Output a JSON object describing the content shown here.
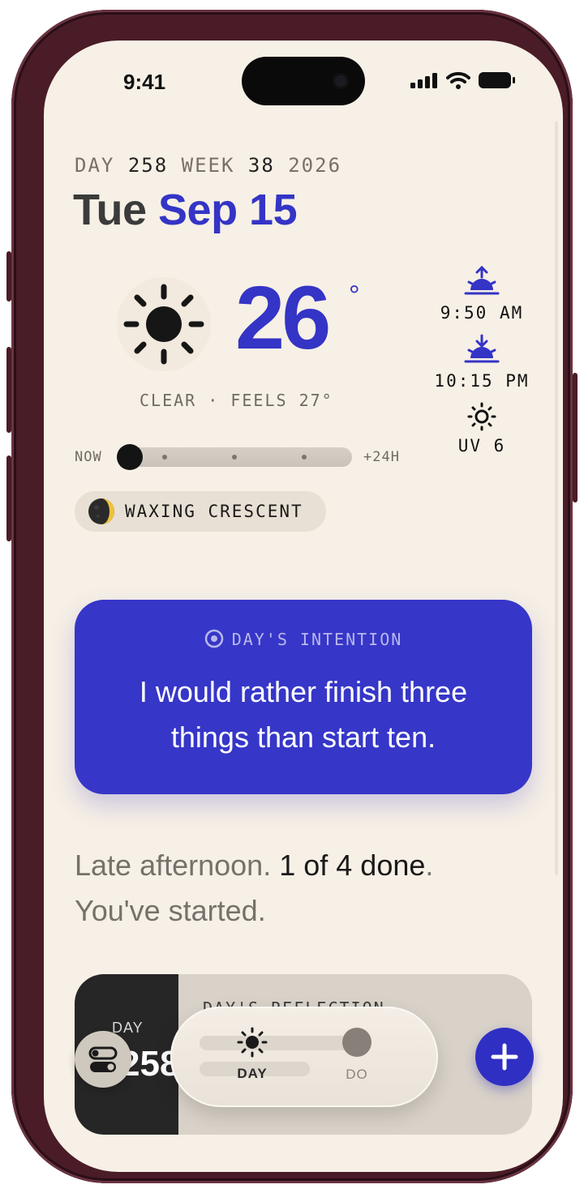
{
  "status_bar": {
    "time": "9:41"
  },
  "date_header": {
    "day_label": "DAY",
    "day_number": "258",
    "week_label": "WEEK",
    "week_number": "38",
    "year": "2026",
    "weekday": "Tue",
    "month_day": "Sep 15"
  },
  "weather": {
    "icon": "sun-icon",
    "temperature": "26",
    "degree_symbol": "°",
    "condition": "CLEAR · FEELS 27°"
  },
  "timeline": {
    "start_label": "NOW",
    "end_label": "+24H",
    "position": 0
  },
  "moon": {
    "icon": "moon-phase-icon",
    "phase": "WAXING CRESCENT"
  },
  "sun_times": {
    "sunrise": "9:50 AM",
    "sunset": "10:15 PM",
    "uv": "UV 6"
  },
  "intention": {
    "icon": "target-icon",
    "heading": "DAY'S INTENTION",
    "quote": "I would rather finish three things than start ten."
  },
  "summary": {
    "part1": "Late afternoon.",
    "part2": "1 of 4 done",
    "part3": ".",
    "part4": "You've started."
  },
  "reflection_card": {
    "day_label": "DAY",
    "day_number": "258",
    "title": "DAY'S REFLECTION"
  },
  "nav": {
    "day_label": "DAY",
    "do_label": "DO",
    "selected": "DAY"
  },
  "colors": {
    "accent": "#3434c6",
    "background": "#f7f0e6",
    "text_dark": "#1a1a1a",
    "text_muted": "#75716b"
  }
}
